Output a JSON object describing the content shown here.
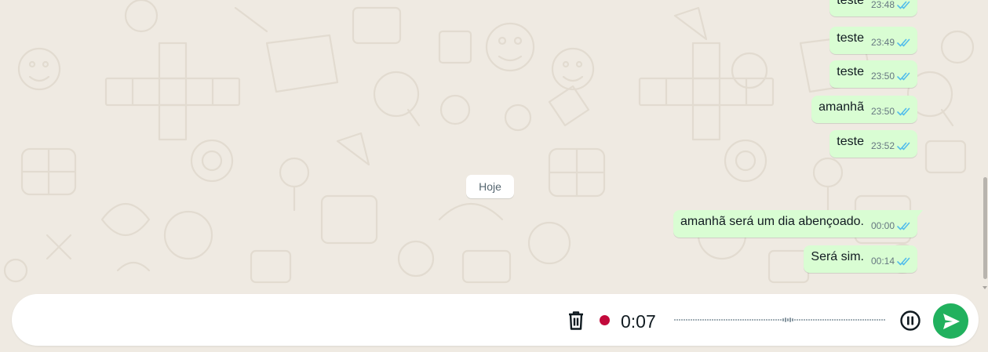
{
  "conversation": {
    "messages": [
      {
        "text": "teste",
        "time": "23:48",
        "status": "read"
      },
      {
        "text": "teste",
        "time": "23:49",
        "status": "read"
      },
      {
        "text": "teste",
        "time": "23:50",
        "status": "read"
      },
      {
        "text": "amanhã",
        "time": "23:50",
        "status": "read"
      },
      {
        "text": "teste",
        "time": "23:52",
        "status": "read"
      },
      {
        "text": "amanhã será um dia abençoado.",
        "time": "00:00",
        "status": "read"
      },
      {
        "text": "Será sim.",
        "time": "00:14",
        "status": "read"
      }
    ],
    "date_separator": "Hoje"
  },
  "recorder": {
    "elapsed": "0:07",
    "delete_icon": "trash-icon",
    "recording_indicator": "recording-dot",
    "pause_icon": "pause-icon",
    "send_icon": "send-icon"
  },
  "colors": {
    "background": "#efeae2",
    "outgoing_bubble": "#d9fdd3",
    "read_ticks": "#53bdeb",
    "recording_dot": "#c2093b",
    "send_button": "#21b15e",
    "date_chip": "#ffffff"
  }
}
